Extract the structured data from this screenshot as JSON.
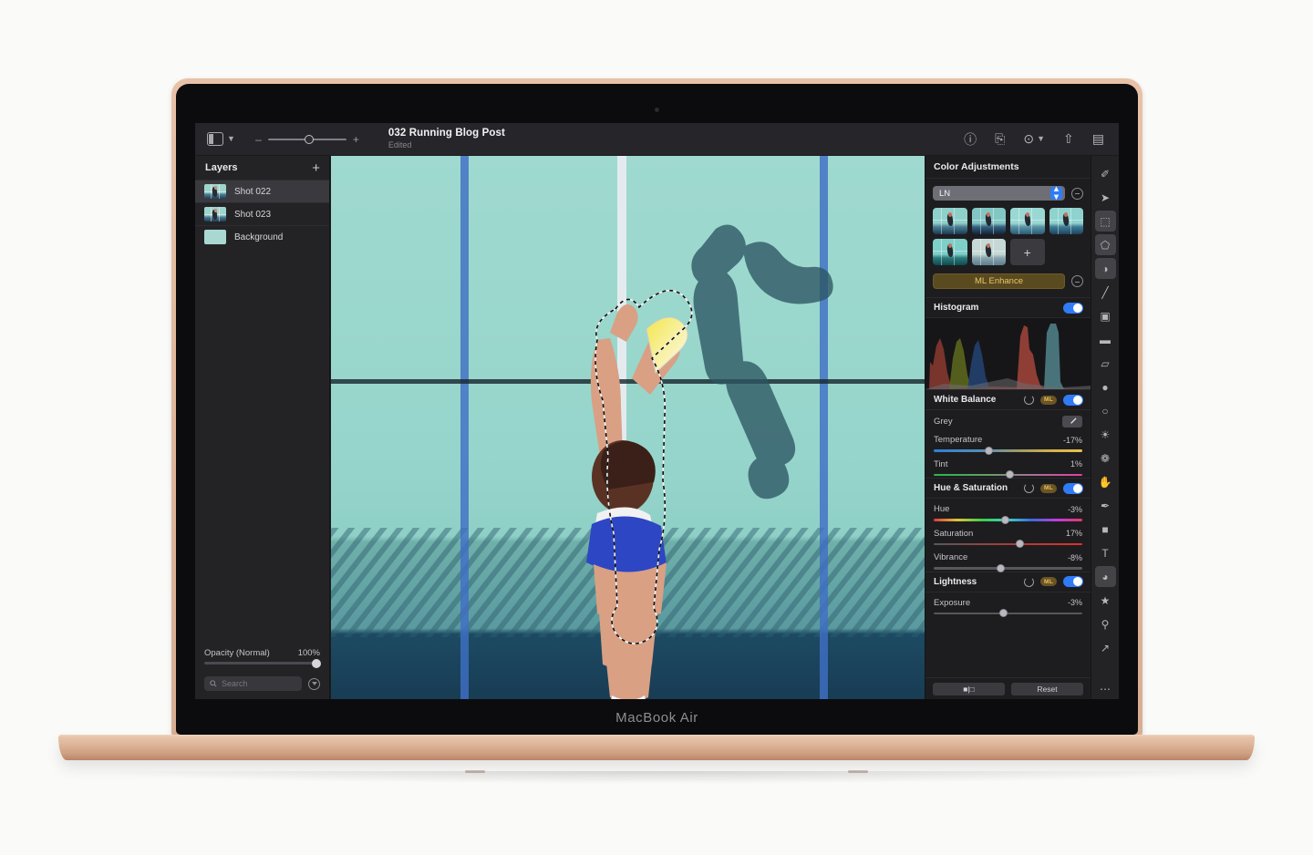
{
  "device": {
    "brand": "MacBook Air"
  },
  "toolbar": {
    "view_icon": "panel-icon",
    "view_chevron": "chevron-down-icon",
    "zoom_out_label": "–",
    "zoom_in_label": "+",
    "zoom_value": 52,
    "document_title": "032 Running Blog Post",
    "document_status": "Edited",
    "right_icons": [
      {
        "name": "info-icon",
        "glyph": "ⓘ"
      },
      {
        "name": "export-icon",
        "glyph": "⎘"
      },
      {
        "name": "more-options-icon",
        "glyph": "⊙"
      },
      {
        "name": "share-icon",
        "glyph": "⇧"
      },
      {
        "name": "inspector-toggle-icon",
        "glyph": "▤"
      }
    ]
  },
  "layers": {
    "title": "Layers",
    "add_label": "+",
    "items": [
      {
        "name": "Shot 022",
        "selected": true,
        "thumb": "photo"
      },
      {
        "name": "Shot 023",
        "selected": false,
        "thumb": "photo"
      },
      {
        "name": "Background",
        "selected": false,
        "thumb": "solid"
      }
    ],
    "opacity_label": "Opacity (Normal)",
    "opacity_value": "100%",
    "opacity_percent": 100,
    "search_placeholder": "Search",
    "search_value": "",
    "filter_icon": "filter-icon"
  },
  "inspector": {
    "title": "Color Adjustments",
    "preset": {
      "value": "LN",
      "stepper_icon": "stepper-arrows-icon",
      "remove_icon": "minus-circle-icon",
      "add_label": "+",
      "thumbnails": 6
    },
    "ml_enhance": {
      "label": "ML Enhance",
      "remove_icon": "minus-circle-icon"
    },
    "histogram": {
      "title": "Histogram",
      "enabled": true
    },
    "sections": [
      {
        "title": "White Balance",
        "enabled": true,
        "ml_badge": "ML",
        "revert_icon": "revert-icon",
        "controls": [
          {
            "label": "Grey",
            "type": "eyedropper",
            "icon": "eyedropper-icon"
          },
          {
            "label": "Temperature",
            "value": "-17%",
            "percent": 37,
            "gradient": "temperature"
          },
          {
            "label": "Tint",
            "value": "1%",
            "percent": 51,
            "gradient": "tint"
          }
        ]
      },
      {
        "title": "Hue & Saturation",
        "enabled": true,
        "ml_badge": "ML",
        "revert_icon": "revert-icon",
        "controls": [
          {
            "label": "Hue",
            "value": "-3%",
            "percent": 48,
            "gradient": "hue"
          },
          {
            "label": "Saturation",
            "value": "17%",
            "percent": 58,
            "gradient": "saturation"
          },
          {
            "label": "Vibrance",
            "value": "-8%",
            "percent": 45,
            "gradient": "plain"
          }
        ]
      },
      {
        "title": "Lightness",
        "enabled": true,
        "ml_badge": "ML",
        "revert_icon": "revert-icon",
        "controls": [
          {
            "label": "Exposure",
            "value": "-3%",
            "percent": 47,
            "gradient": "plain"
          }
        ]
      }
    ],
    "bottom_bar": {
      "compare_label": "■|□",
      "reset_label": "Reset"
    }
  },
  "tool_rail": {
    "tools": [
      {
        "name": "retouch-icon",
        "glyph": "✐",
        "active": false
      },
      {
        "name": "move-pointer-icon",
        "glyph": "➤",
        "active": false
      },
      {
        "name": "marquee-select-icon",
        "glyph": "⬚",
        "active": true
      },
      {
        "name": "lasso-select-icon",
        "glyph": "⬠",
        "active": true
      },
      {
        "name": "magic-select-icon",
        "glyph": "◑",
        "active": true
      },
      {
        "name": "brush-icon",
        "glyph": "╱",
        "active": false
      },
      {
        "name": "paint-bucket-icon",
        "glyph": "▣",
        "active": false
      },
      {
        "name": "blur-icon",
        "glyph": "▬",
        "active": false
      },
      {
        "name": "eraser-icon",
        "glyph": "▱",
        "active": false
      },
      {
        "name": "clone-stamp-icon",
        "glyph": "●",
        "active": false
      },
      {
        "name": "dodge-burn-icon",
        "glyph": "○",
        "active": false
      },
      {
        "name": "sharpen-icon",
        "glyph": "☀",
        "active": false
      },
      {
        "name": "smudge-icon",
        "glyph": "❁",
        "active": false
      },
      {
        "name": "liquify-icon",
        "glyph": "✋",
        "active": false
      },
      {
        "name": "pen-icon",
        "glyph": "✒",
        "active": false
      },
      {
        "name": "shape-icon",
        "glyph": "■",
        "active": false
      },
      {
        "name": "text-icon",
        "glyph": "T",
        "active": false
      },
      {
        "name": "gradient-icon",
        "glyph": "◕",
        "active": true
      },
      {
        "name": "effects-icon",
        "glyph": "★",
        "active": false
      },
      {
        "name": "zoom-icon",
        "glyph": "⚲",
        "active": false
      },
      {
        "name": "color-picker-icon",
        "glyph": "↗",
        "active": false
      },
      {
        "name": "more-tools-icon",
        "glyph": "⋯",
        "active": false
      }
    ]
  },
  "canvas": {
    "subject": "overhead photo of a runner on a green running track with blue lane lines and a cast shadow",
    "selection_active": true
  }
}
